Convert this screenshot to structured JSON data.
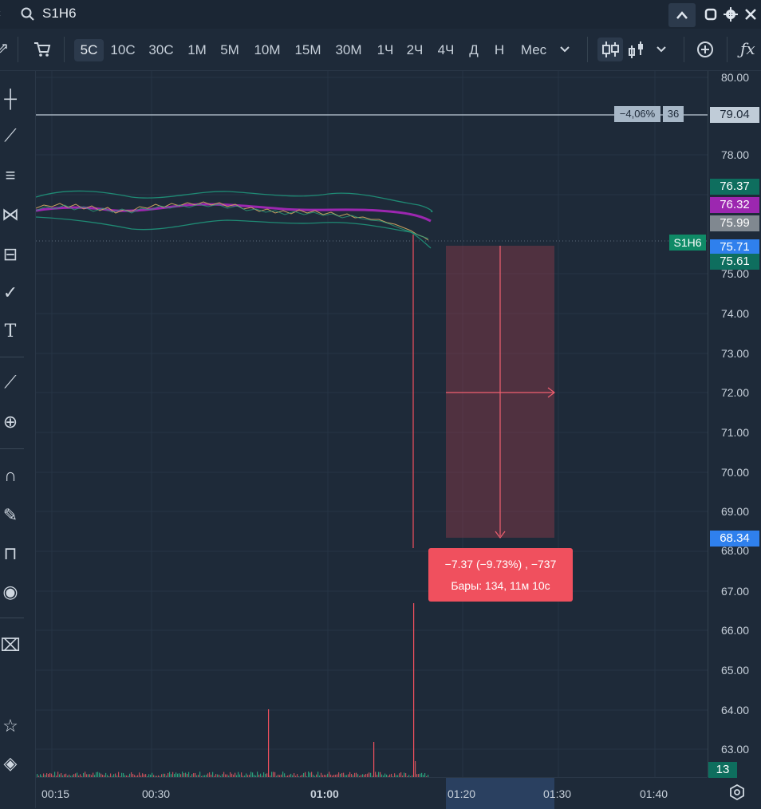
{
  "header": {
    "symbol": "S1H6",
    "icons": [
      "search-icon",
      "chevron-up-icon",
      "restore-icon",
      "settings-icon",
      "close-icon"
    ]
  },
  "toolbar": {
    "timeframes": [
      "5С",
      "10С",
      "30С",
      "1М",
      "5М",
      "10М",
      "15М",
      "30М",
      "1Ч",
      "2Ч",
      "4Ч",
      "Д",
      "Н",
      "Мес"
    ],
    "active_timeframe": "5С",
    "icons": [
      "cart-icon",
      "chevron-down-icon",
      "candles-icon",
      "bars-icon",
      "chevron-down-icon",
      "add-indicator-icon",
      "fx-icon"
    ]
  },
  "left_tools": [
    "crosshair-icon",
    "trend-line-icon",
    "fib-lines-icon",
    "pattern-icon",
    "forecast-icon",
    "brush-icon",
    "text-icon",
    "ruler-icon",
    "zoom-in-icon",
    "magnet-icon",
    "lock-drawing-icon",
    "unlock-icon",
    "eye-icon",
    "trash-icon",
    "star-icon",
    "layers-icon"
  ],
  "price_axis": {
    "ticks": [
      "80.00",
      "78.00",
      "75.00",
      "74.00",
      "73.00",
      "72.00",
      "71.00",
      "70.00",
      "69.00",
      "68.00",
      "67.00",
      "66.00",
      "65.00",
      "64.00",
      "63.00"
    ],
    "badges": {
      "hline": "79.04",
      "upper_band": "76.37",
      "ma": "76.32",
      "gray": "75.99",
      "last": "75.71",
      "lower_band": "75.61",
      "target": "68.34",
      "volume": "13"
    },
    "colors": {
      "hline": "#c0ccd8",
      "upper_band": "#0e6e5e",
      "ma": "#9c27b0",
      "gray": "#808890",
      "last": "#2f80ed",
      "lower_band": "#0e6e5e",
      "target": "#2f80ed",
      "volume": "#0e6e5e"
    }
  },
  "hline_label": {
    "percent": "−4,06%",
    "bars": "36"
  },
  "symbol_label": "S1H6",
  "time_axis": {
    "ticks": [
      "00:15",
      "00:30",
      "01:00",
      "01:20",
      "01:30",
      "01:40"
    ],
    "highlighted": "01:20"
  },
  "measurement": {
    "line1": "−7.37 (−9.73%) , −737",
    "line2": "Бары: 134, 11м 10с"
  },
  "chart_data": {
    "type": "line",
    "title": "",
    "ylim": [
      62.7,
      80.1
    ],
    "grid": true,
    "series": [],
    "horizontal_line": 79.04,
    "last_price": 75.71,
    "measure_from": 75.71,
    "measure_to": 68.34,
    "measure_change": -7.37
  }
}
